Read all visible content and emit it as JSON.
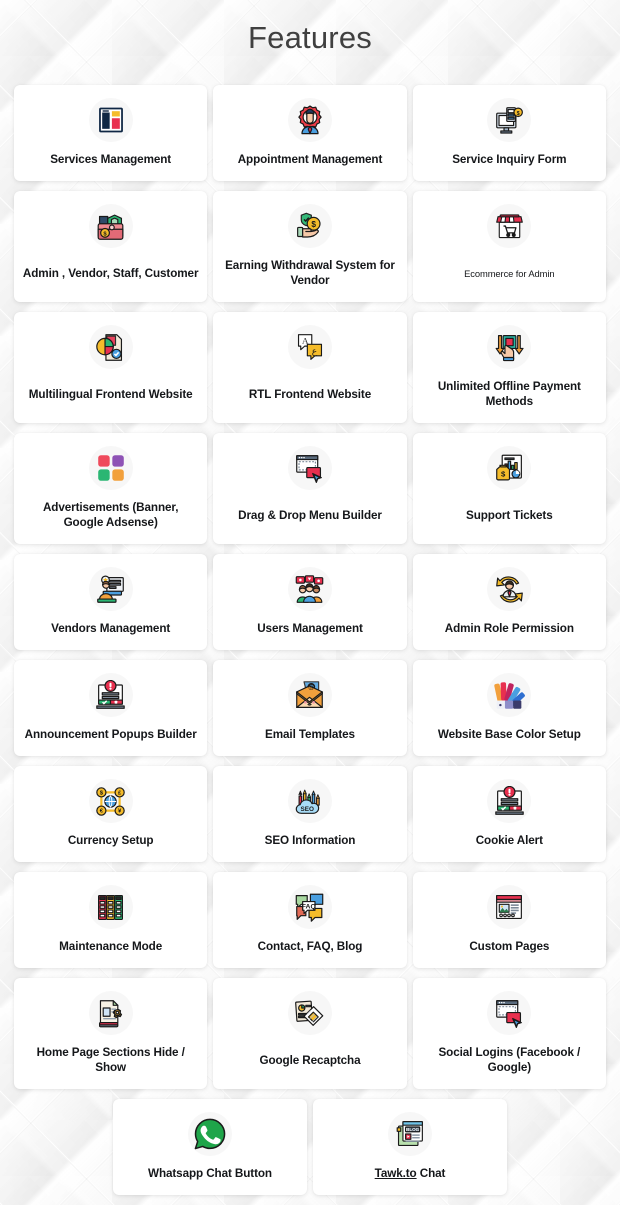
{
  "page": {
    "title": "Features",
    "title_color": "#404040",
    "background_color": "#f4f4f4",
    "card_background": "#ffffff",
    "label_color": "#15171a"
  },
  "rows": [
    {
      "id": "row-1",
      "cards": [
        {
          "label": "Services Management",
          "icon": "newspaper-layout-icon",
          "style": "normal"
        },
        {
          "label": "Appointment Management",
          "icon": "gear-person-icon",
          "style": "normal"
        },
        {
          "label": "Service Inquiry Form",
          "icon": "pos-terminal-icon",
          "style": "normal"
        }
      ]
    },
    {
      "id": "row-2",
      "cards": [
        {
          "label": "Admin , Vendor, Staff, Customer",
          "icon": "wallet-money-icon",
          "style": "normal"
        },
        {
          "label": "Earning Withdrawal System for Vendor",
          "icon": "hand-coin-icon",
          "style": "normal"
        },
        {
          "label": "Ecommerce for Admin",
          "icon": "shop-cart-icon",
          "style": "small"
        }
      ]
    },
    {
      "id": "row-3",
      "cards": [
        {
          "label": "Multilingual Frontend Website",
          "icon": "pie-document-icon",
          "style": "normal"
        },
        {
          "label": "RTL Frontend Website",
          "icon": "translate-bubbles-icon",
          "style": "normal"
        },
        {
          "label": "Unlimited Offline Payment Methods",
          "icon": "hand-transfer-icon",
          "style": "normal"
        }
      ]
    },
    {
      "id": "row-4",
      "cards": [
        {
          "label": "Advertisements (Banner, Google Adsense)",
          "icon": "four-squares-icon",
          "style": "normal"
        },
        {
          "label": "Drag & Drop Menu Builder",
          "icon": "drag-drop-cursor-icon",
          "style": "normal"
        },
        {
          "label": "Support Tickets",
          "icon": "report-money-icon",
          "style": "normal"
        }
      ]
    },
    {
      "id": "row-5",
      "cards": [
        {
          "label": "Vendors Management",
          "icon": "vendor-desk-icon",
          "style": "normal"
        },
        {
          "label": "Users Management",
          "icon": "users-group-icon",
          "style": "normal"
        },
        {
          "label": "Admin Role Permission",
          "icon": "role-cycle-icon",
          "style": "normal"
        }
      ]
    },
    {
      "id": "row-6",
      "cards": [
        {
          "label": "Announcement Popups Builder",
          "icon": "popup-alert-icon",
          "style": "normal"
        },
        {
          "label": "Email Templates",
          "icon": "email-envelope-icon",
          "style": "normal"
        },
        {
          "label": "Website Base Color Setup",
          "icon": "color-swatch-icon",
          "style": "normal"
        }
      ]
    },
    {
      "id": "row-7",
      "cards": [
        {
          "label": "Currency Setup",
          "icon": "currency-globe-icon",
          "style": "normal"
        },
        {
          "label": "SEO Information",
          "icon": "seo-cloud-icon",
          "style": "normal"
        },
        {
          "label": "Cookie Alert",
          "icon": "popup-alert-icon",
          "style": "normal"
        }
      ]
    },
    {
      "id": "row-8",
      "cards": [
        {
          "label": "Maintenance Mode",
          "icon": "server-rack-icon",
          "style": "normal"
        },
        {
          "label": "Contact, FAQ, Blog",
          "icon": "faq-bubbles-icon",
          "style": "normal"
        },
        {
          "label": "Custom Pages",
          "icon": "webpage-image-icon",
          "style": "normal"
        }
      ]
    },
    {
      "id": "row-9",
      "cards": [
        {
          "label": "Home Page Sections Hide / Show",
          "icon": "document-gear-icon",
          "style": "normal"
        },
        {
          "label": "Google Recaptcha",
          "icon": "recaptcha-pages-icon",
          "style": "normal"
        },
        {
          "label": "Social Logins (Facebook / Google)",
          "icon": "drag-drop-cursor-icon",
          "style": "normal"
        }
      ]
    },
    {
      "id": "row-10",
      "centered": true,
      "cards": [
        {
          "label": "Whatsapp Chat Button",
          "icon": "whatsapp-icon",
          "style": "normal"
        },
        {
          "label_prefix": "Tawk.to",
          "label_suffix": " Chat",
          "label": "Tawk.to Chat",
          "icon": "blog-window-icon",
          "style": "linked"
        }
      ]
    }
  ],
  "icon_colors": {
    "navy": "#0f2744",
    "red": "#e8304f",
    "yellow": "#f5bc2a",
    "green": "#2bb673",
    "purple": "#8e52b5",
    "orange": "#f2a03c",
    "blue": "#4a9fe0",
    "pink": "#ef4a5c",
    "skin": "#f7c9a8",
    "outline": "#1a1a1a"
  }
}
